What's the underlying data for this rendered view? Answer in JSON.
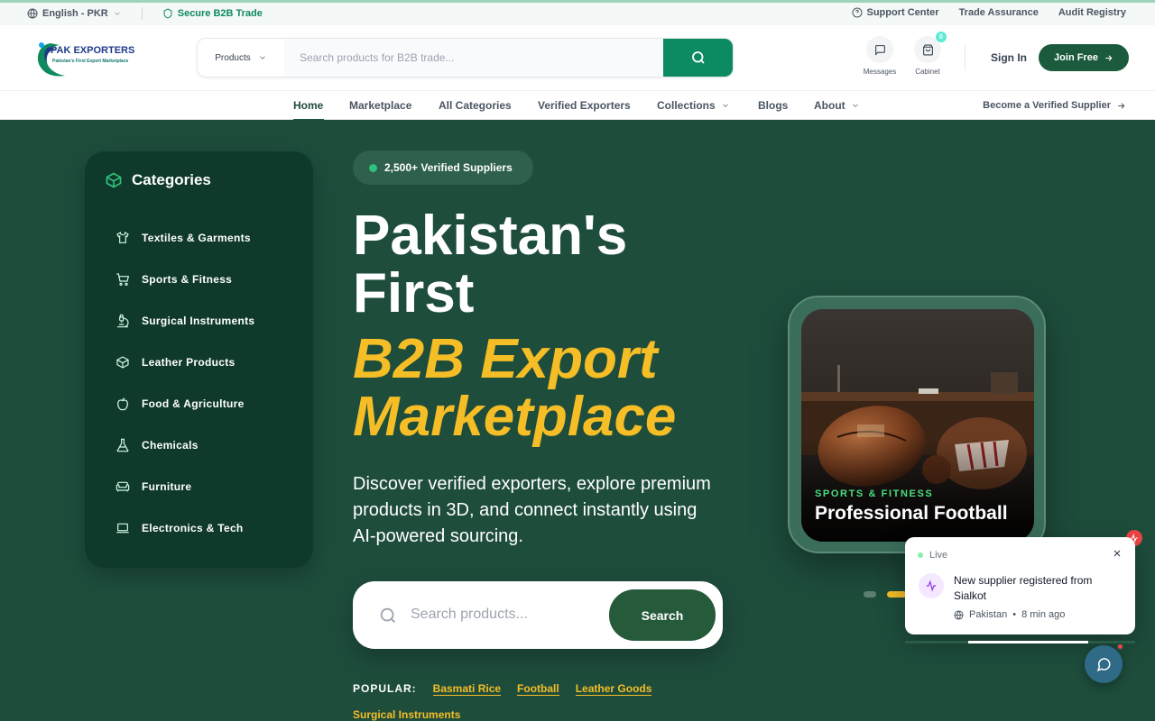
{
  "topbar": {
    "language": "English - PKR",
    "secure": "Secure B2B Trade",
    "links": [
      "Support Center",
      "Trade Assurance",
      "Audit Registry"
    ]
  },
  "header": {
    "logo_name": "PAK EXPORTERS",
    "logo_tagline": "Pakistan's First Export Marketplace",
    "search_category": "Products",
    "search_placeholder": "Search products for B2B trade...",
    "messages_label": "Messages",
    "cabinet_label": "Cabinet",
    "cabinet_count": "0",
    "signin": "Sign In",
    "join": "Join Free"
  },
  "nav": {
    "items": [
      "Home",
      "Marketplace",
      "All Categories",
      "Verified Exporters",
      "Collections",
      "Blogs",
      "About"
    ],
    "become": "Become a Verified Supplier"
  },
  "categories": {
    "title": "Categories",
    "items": [
      {
        "label": "Textiles & Garments",
        "icon": "shirt-icon"
      },
      {
        "label": "Sports & Fitness",
        "icon": "cart-icon"
      },
      {
        "label": "Surgical Instruments",
        "icon": "microscope-icon"
      },
      {
        "label": "Leather Products",
        "icon": "box-icon"
      },
      {
        "label": "Food & Agriculture",
        "icon": "apple-icon"
      },
      {
        "label": "Chemicals",
        "icon": "flask-icon"
      },
      {
        "label": "Furniture",
        "icon": "sofa-icon"
      },
      {
        "label": "Electronics & Tech",
        "icon": "laptop-icon"
      }
    ]
  },
  "hero": {
    "pill": "2,500+ Verified Suppliers",
    "title_line1": "Pakistan's First",
    "title_line2": "B2B Export Marketplace",
    "lead": "Discover verified exporters, explore premium products in 3D, and connect instantly using AI-powered sourcing.",
    "search_placeholder": "Search products...",
    "search_button": "Search",
    "popular_label": "POPULAR:",
    "popular_tags": [
      "Basmati Rice",
      "Football",
      "Leather Goods",
      "Surgical Instruments"
    ]
  },
  "featured": {
    "category": "SPORTS & FITNESS",
    "product": "Professional Football"
  },
  "toast": {
    "status": "Live",
    "message": "New supplier registered from Sialkot",
    "location": "Pakistan",
    "time": "8 min ago",
    "progress": 0.72
  },
  "colors": {
    "brand_green": "#1b5a3c",
    "hero_bg": "#1e4d3c",
    "accent_gold": "#f5bd26",
    "search_green": "#0c8a62"
  }
}
